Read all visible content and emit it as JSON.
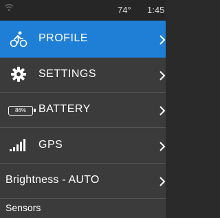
{
  "status_bar": {
    "wifi_icon": "wifi-icon",
    "temperature": "74°",
    "time": "1:45"
  },
  "menu": [
    {
      "key": "profile",
      "label": "PROFILE",
      "icon": "cyclist-icon",
      "active": true
    },
    {
      "key": "settings",
      "label": "SETTINGS",
      "icon": "gear-icon",
      "active": false
    },
    {
      "key": "battery",
      "label": "BATTERY",
      "icon": "battery-icon",
      "battery_percent": "86%",
      "active": false
    },
    {
      "key": "gps",
      "label": "GPS",
      "icon": "signal-bars-icon",
      "active": false
    },
    {
      "key": "brightness",
      "label": "Brightness - AUTO",
      "active": false
    }
  ],
  "sensors": {
    "label": "Sensors"
  },
  "colors": {
    "accent": "#1f7fd6",
    "row_bg": "#3b3b3b",
    "divider": "#555555"
  }
}
